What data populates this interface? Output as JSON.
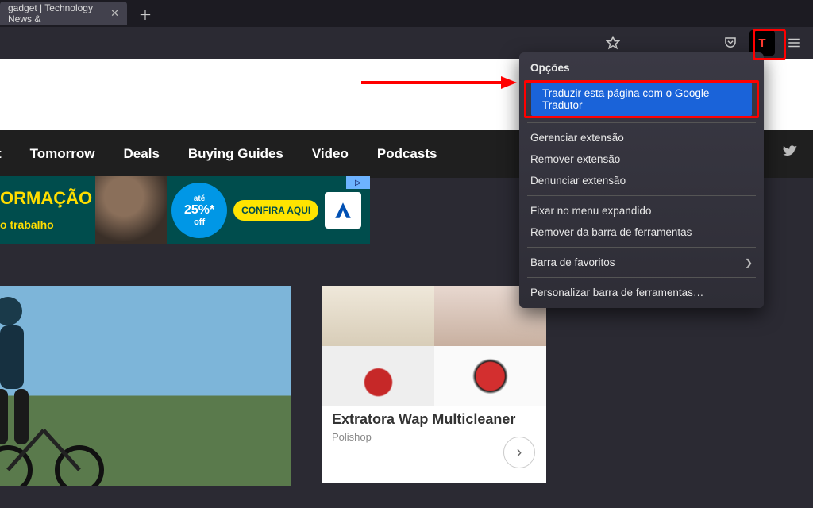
{
  "tab": {
    "title": "gadget | Technology News &"
  },
  "toolbar": {
    "ext_letter": "T"
  },
  "nav": {
    "items": [
      "t",
      "Tomorrow",
      "Deals",
      "Buying Guides",
      "Video",
      "Podcasts"
    ]
  },
  "ad_banner": {
    "headline": "ORMAÇÃO",
    "sub": "o trabalho",
    "circle_top": "até",
    "circle_mid": "25%*",
    "circle_bot": "off",
    "cta": "CONFIRA AQUI",
    "mark": "▷"
  },
  "ad_box": {
    "title": "Extratora Wap Multicleaner",
    "brand": "Polishop",
    "mark": "▷"
  },
  "menu": {
    "header": "Opções",
    "translate": "Traduzir esta página com o Google Tradutor",
    "group1": [
      "Gerenciar extensão",
      "Remover extensão",
      "Denunciar extensão"
    ],
    "group2": [
      "Fixar no menu expandido",
      "Remover da barra de ferramentas"
    ],
    "favorites": "Barra de favoritos",
    "customize": "Personalizar barra de ferramentas…"
  }
}
